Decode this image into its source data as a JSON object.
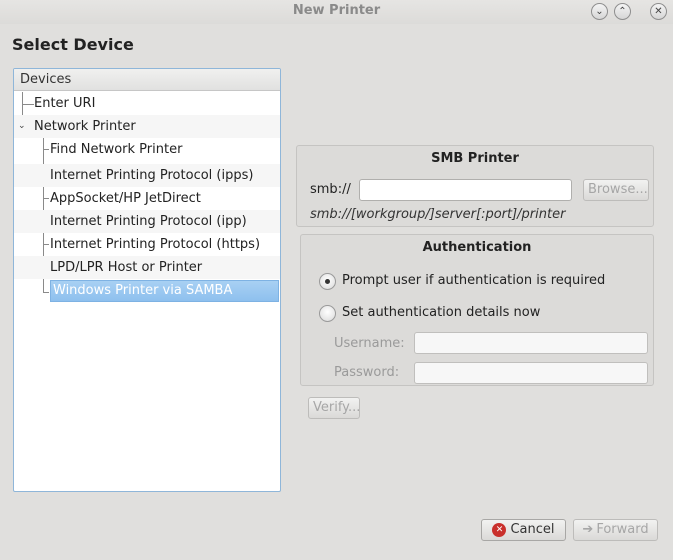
{
  "window": {
    "title": "New Printer"
  },
  "heading": "Select Device",
  "devices": {
    "header": "Devices",
    "items": [
      {
        "label": "Enter URI",
        "level": 0
      },
      {
        "label": "Network Printer",
        "level": 0,
        "expanded": true
      },
      {
        "label": "Find Network Printer",
        "level": 1
      },
      {
        "label": "Internet Printing Protocol (ipps)",
        "level": 1
      },
      {
        "label": "AppSocket/HP JetDirect",
        "level": 1
      },
      {
        "label": "Internet Printing Protocol (ipp)",
        "level": 1
      },
      {
        "label": "Internet Printing Protocol (https)",
        "level": 1
      },
      {
        "label": "LPD/LPR Host or Printer",
        "level": 1
      },
      {
        "label": "Windows Printer via SAMBA",
        "level": 1,
        "selected": true
      }
    ]
  },
  "smb": {
    "title": "SMB Printer",
    "uri_label": "smb://",
    "uri_value": "",
    "browse_label": "Browse...",
    "hint": "smb://[workgroup/]server[:port]/printer"
  },
  "auth": {
    "title": "Authentication",
    "option_prompt": "Prompt user if authentication is required",
    "option_set": "Set authentication details now",
    "selected": "prompt",
    "username_label": "Username:",
    "password_label": "Password:",
    "username_value": "",
    "password_value": ""
  },
  "verify_label": "Verify...",
  "cancel_label": "Cancel",
  "forward_label": "Forward",
  "colors": {
    "selection": "#8ec0ee",
    "focus_border": "#8fb6d9"
  }
}
